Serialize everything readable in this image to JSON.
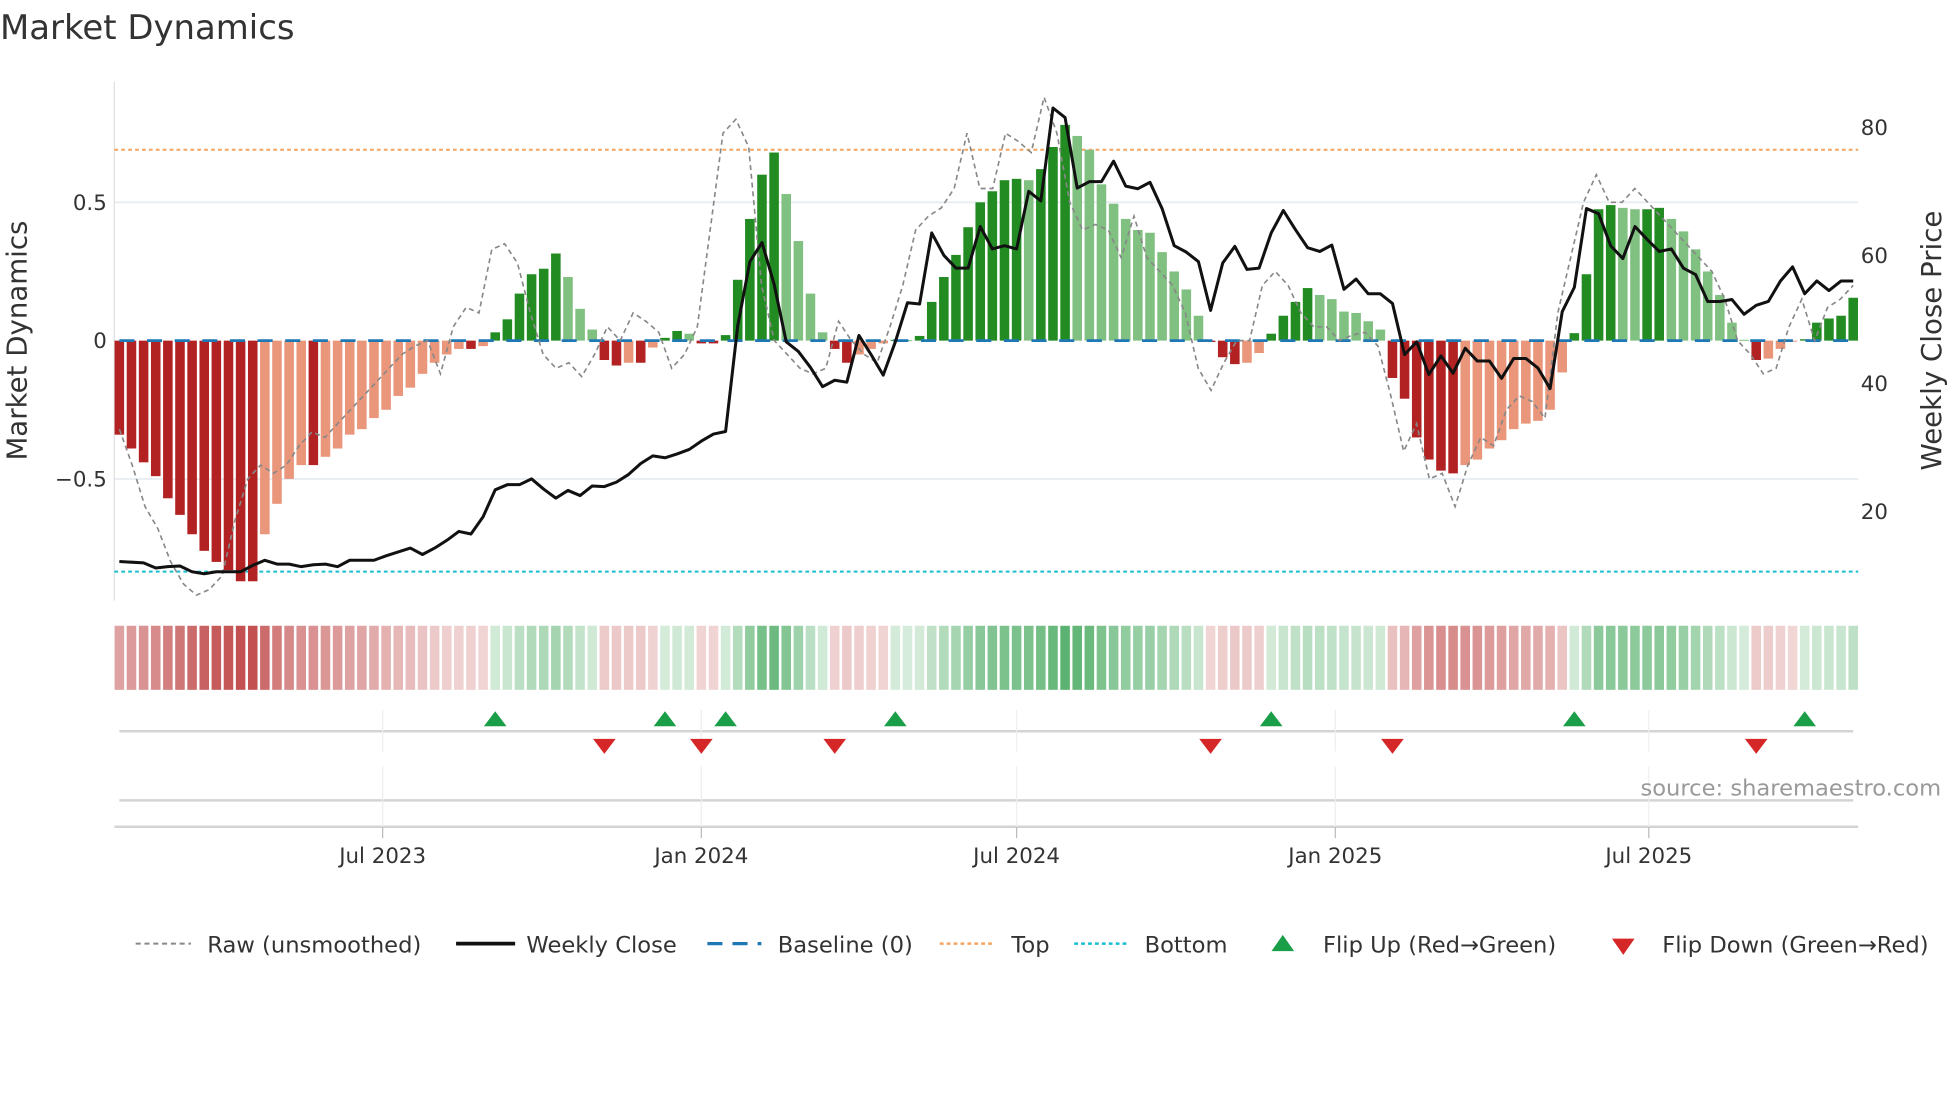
{
  "title": "Market Dynamics",
  "source": "source: sharemaestro.com",
  "chart_data": {
    "type": "bar",
    "title": "Market Dynamics",
    "ylabel": "Market Dynamics",
    "y2label": "Weekly Close Price",
    "start_date": "2023-01-30",
    "interval_days": 7,
    "ylim": [
      -0.94,
      0.936
    ],
    "y2lim": [
      6.1,
      87.1
    ],
    "yticks": [
      {
        "value": 0.5,
        "label": "0.5"
      },
      {
        "value": 0,
        "label": "0"
      },
      {
        "value": -0.5,
        "label": "−0.5"
      }
    ],
    "y2ticks": [
      {
        "value": 80,
        "label": "80"
      },
      {
        "value": 60,
        "label": "60"
      },
      {
        "value": 40,
        "label": "40"
      },
      {
        "value": 20,
        "label": "20"
      }
    ],
    "xticks": [
      {
        "date": "2023-07-01",
        "label": "Jul 2023"
      },
      {
        "date": "2024-01-01",
        "label": "Jan 2024"
      },
      {
        "date": "2024-07-01",
        "label": "Jul 2024"
      },
      {
        "date": "2025-01-01",
        "label": "Jan 2025"
      },
      {
        "date": "2025-07-01",
        "label": "Jul 2025"
      }
    ],
    "baseline": 0,
    "top": 0.69,
    "bottom": -0.835,
    "colors": {
      "neg_strong": "#b22222",
      "neg_weak": "#e9967a",
      "pos_strong": "#228b22",
      "pos_weak": "#80c080",
      "close": "#111111",
      "raw": "#888888",
      "baseline": "#1f77b4",
      "top": "#f4a460",
      "bottom": "#17becf",
      "flip_up": "#1a9e48",
      "flip_down": "#d62728"
    },
    "momentum": [
      -0.34,
      -0.39,
      -0.44,
      -0.49,
      -0.57,
      -0.63,
      -0.7,
      -0.76,
      -0.8,
      -0.83,
      -0.87,
      -0.87,
      -0.7,
      -0.59,
      -0.5,
      -0.45,
      -0.45,
      -0.42,
      -0.39,
      -0.34,
      -0.32,
      -0.28,
      -0.25,
      -0.2,
      -0.17,
      -0.12,
      -0.08,
      -0.05,
      -0.03,
      -0.03,
      -0.02,
      0.03,
      0.077,
      0.17,
      0.24,
      0.26,
      0.315,
      0.23,
      0.115,
      0.04,
      -0.07,
      -0.09,
      -0.08,
      -0.08,
      -0.025,
      0.01,
      0.035,
      0.025,
      -0.01,
      -0.01,
      0.02,
      0.22,
      0.44,
      0.6,
      0.68,
      0.53,
      0.36,
      0.17,
      0.03,
      -0.03,
      -0.08,
      -0.05,
      -0.03,
      -0.01,
      0.003,
      0.002,
      0.017,
      0.14,
      0.23,
      0.31,
      0.41,
      0.5,
      0.54,
      0.58,
      0.585,
      0.58,
      0.62,
      0.7,
      0.78,
      0.74,
      0.69,
      0.565,
      0.495,
      0.44,
      0.4,
      0.39,
      0.32,
      0.25,
      0.185,
      0.09,
      -0.005,
      -0.06,
      -0.085,
      -0.08,
      -0.045,
      0.025,
      0.09,
      0.14,
      0.19,
      0.165,
      0.15,
      0.105,
      0.1,
      0.07,
      0.04,
      -0.135,
      -0.21,
      -0.35,
      -0.43,
      -0.47,
      -0.48,
      -0.45,
      -0.43,
      -0.39,
      -0.36,
      -0.32,
      -0.3,
      -0.29,
      -0.25,
      -0.115,
      0.027,
      0.24,
      0.475,
      0.49,
      0.48,
      0.475,
      0.475,
      0.48,
      0.44,
      0.395,
      0.33,
      0.25,
      0.165,
      0.065,
      0.003,
      -0.07,
      -0.065,
      -0.03,
      -0.002,
      0.005,
      0.065,
      0.08,
      0.09,
      0.155
    ],
    "weekly_close": [
      12.2,
      12.1,
      12.0,
      11.2,
      11.4,
      11.5,
      10.6,
      10.3,
      10.6,
      10.6,
      10.6,
      11.6,
      12.4,
      11.8,
      11.8,
      11.4,
      11.7,
      11.8,
      11.4,
      12.4,
      12.4,
      12.4,
      13.1,
      13.7,
      14.3,
      13.3,
      14.3,
      15.5,
      16.9,
      16.5,
      19.2,
      23.4,
      24.2,
      24.2,
      25.1,
      23.5,
      22.1,
      23.3,
      22.5,
      24.0,
      23.9,
      24.6,
      25.8,
      27.5,
      28.7,
      28.4,
      29.0,
      29.7,
      31.0,
      32.1,
      32.5,
      49,
      59,
      62,
      55.5,
      46.5,
      45,
      42.5,
      39.5,
      40.5,
      40.2,
      47.5,
      44.5,
      41.3,
      46.5,
      52.6,
      52.4,
      63.5,
      60,
      58,
      58,
      64.5,
      61,
      61.5,
      61,
      70,
      68.5,
      83,
      81.5,
      70.5,
      71.5,
      71.5,
      74.7,
      70.8,
      70.4,
      71.4,
      67.3,
      61.5,
      60.5,
      59,
      51.4,
      58.8,
      61.4,
      57.8,
      58,
      63.5,
      67,
      64,
      61.2,
      60.6,
      61.6,
      54.7,
      56.3,
      54,
      54,
      52.5,
      44.5,
      46.5,
      41.4,
      44.3,
      41.6,
      45.5,
      43.5,
      43.5,
      40.8,
      43.9,
      43.9,
      42.4,
      39.2,
      51.2,
      55,
      67.3,
      66.5,
      61.5,
      59.5,
      64.5,
      62.5,
      60.6,
      61,
      58,
      57,
      52.8,
      52.8,
      53.1,
      50.8,
      52.2,
      52.8,
      56,
      58.2,
      54,
      56,
      54.5,
      56,
      56
    ],
    "raw": [
      -0.32,
      -0.45,
      -0.6,
      -0.68,
      -0.8,
      -0.88,
      -0.92,
      -0.9,
      -0.85,
      -0.65,
      -0.5,
      -0.45,
      -0.48,
      -0.45,
      -0.38,
      -0.33,
      -0.35,
      -0.3,
      -0.25,
      -0.2,
      -0.15,
      -0.1,
      -0.05,
      -0.02,
      0.0,
      -0.12,
      0.05,
      0.12,
      0.1,
      0.33,
      0.35,
      0.28,
      0.1,
      -0.05,
      -0.1,
      -0.08,
      -0.13,
      -0.05,
      0.05,
      0.0,
      0.1,
      0.07,
      0.03,
      -0.1,
      -0.05,
      0.05,
      0.4,
      0.75,
      0.8,
      0.7,
      0.2,
      0.0,
      -0.05,
      -0.1,
      -0.12,
      -0.1,
      0.07,
      0.0,
      -0.05,
      -0.08,
      0.05,
      0.2,
      0.4,
      0.45,
      0.48,
      0.55,
      0.75,
      0.55,
      0.55,
      0.75,
      0.72,
      0.68,
      0.88,
      0.75,
      0.5,
      0.4,
      0.42,
      0.4,
      0.3,
      0.45,
      0.3,
      0.25,
      0.2,
      0.1,
      -0.1,
      -0.18,
      -0.08,
      0.0,
      0.0,
      0.2,
      0.25,
      0.2,
      0.1,
      0.05,
      0.05,
      0.0,
      0.02,
      0.03,
      -0.02,
      -0.2,
      -0.4,
      -0.3,
      -0.5,
      -0.48,
      -0.6,
      -0.45,
      -0.35,
      -0.38,
      -0.25,
      -0.2,
      -0.22,
      -0.28,
      0.1,
      0.3,
      0.5,
      0.6,
      0.5,
      0.5,
      0.55,
      0.5,
      0.45,
      0.4,
      0.35,
      0.3,
      0.25,
      0.15,
      0.0,
      -0.05,
      -0.12,
      -0.1,
      0.05,
      0.15,
      0.0,
      0.12,
      0.15,
      0.2
    ],
    "flip_up_index": [
      31,
      45,
      50,
      64,
      95,
      120,
      139
    ],
    "flip_down_index": [
      40,
      48,
      59,
      90,
      105,
      135
    ],
    "legend": {
      "raw": "Raw (unsmoothed)",
      "close": "Weekly Close",
      "baseline": "Baseline (0)",
      "top": "Top",
      "bottom": "Bottom",
      "flip_up": "Flip Up (Red→Green)",
      "flip_down": "Flip Down (Green→Red)"
    }
  }
}
